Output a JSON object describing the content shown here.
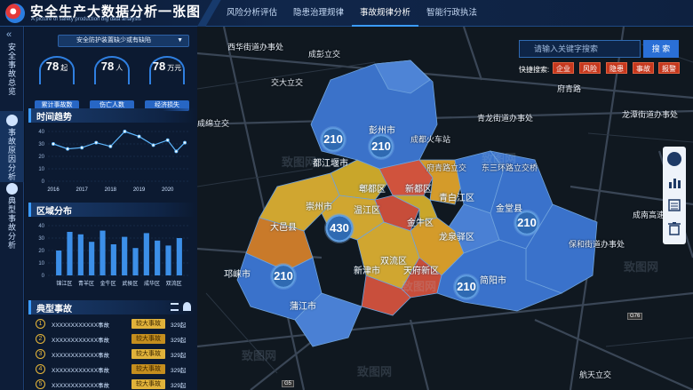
{
  "header": {
    "title": "安全生产大数据分析一张图",
    "subtitle": "A picture of safety production big data analysis",
    "nav": [
      "风险分析评估",
      "隐患治理规律",
      "事故规律分析",
      "智能行政执法"
    ],
    "active_nav": 2
  },
  "sidebar": {
    "tabs": [
      "安全事故总览",
      "事故原因分析",
      "典型事故分析"
    ]
  },
  "overview": {
    "dropdown": "安全防护装置缺少或有缺陷",
    "stats": [
      {
        "value": "78",
        "unit": "起",
        "label": "累计事故数"
      },
      {
        "value": "78",
        "unit": "人",
        "label": "伤亡人数"
      },
      {
        "value": "78",
        "unit": "万元",
        "label": "经济损失"
      }
    ]
  },
  "trend": {
    "title": "时间趋势",
    "chart_data": {
      "type": "line",
      "x": [
        "2016",
        "2017",
        "2018",
        "2019",
        "2020"
      ],
      "values": [
        30,
        26,
        27,
        31,
        28,
        40,
        36,
        29,
        33,
        24,
        31
      ],
      "x_points": [
        2016,
        2016.5,
        2017,
        2017.5,
        2018,
        2018.5,
        2019,
        2019.5,
        2020,
        2020.3,
        2020.6
      ],
      "yticks": [
        "0",
        "10",
        "20",
        "30",
        "40"
      ],
      "ylim": [
        0,
        40
      ]
    }
  },
  "region": {
    "title": "区域分布",
    "chart_data": {
      "type": "bar",
      "categories": [
        "锦江区",
        "青羊区",
        "金牛区",
        "武侯区",
        "成华区",
        "双流区"
      ],
      "values": [
        20,
        35,
        33,
        27,
        36,
        25,
        31,
        22,
        34,
        28,
        24,
        30
      ],
      "yticks": [
        "0",
        "10",
        "20",
        "30",
        "40"
      ],
      "ylim": [
        0,
        40
      ]
    }
  },
  "typical": {
    "title": "典型事故",
    "rows": [
      {
        "num": "1",
        "title": "XXXXXXXXXXXX事故",
        "tag": "较大事故",
        "date": "329起"
      },
      {
        "num": "2",
        "title": "XXXXXXXXXXXX事故",
        "tag": "较大事故",
        "date": "329起"
      },
      {
        "num": "3",
        "title": "XXXXXXXXXXXX事故",
        "tag": "较大事故",
        "date": "329起"
      },
      {
        "num": "4",
        "title": "XXXXXXXXXXXX事故",
        "tag": "较大事故",
        "date": "329起"
      },
      {
        "num": "5",
        "title": "XXXXXXXXXXXX事故",
        "tag": "较大事故",
        "date": "329起"
      }
    ]
  },
  "map": {
    "districts": [
      "彭州市",
      "都江堰市",
      "新都区",
      "郫都区",
      "青白江区",
      "崇州市",
      "温江区",
      "金牛区",
      "金堂县",
      "大邑县",
      "金牛区",
      "双流区",
      "天府新区",
      "新津市",
      "龙泉驿区",
      "简阳市",
      "邛崃市",
      "蒲江市",
      "青羊区",
      "成华区"
    ],
    "bubbles": [
      "210",
      "210",
      "430",
      "210",
      "210",
      "210"
    ],
    "places": [
      "西华街道办事处",
      "成彭立交",
      "交大立交",
      "成绵立交",
      "府青路立交",
      "青龙街道办事处",
      "龙潭街道办事处",
      "成都火车站",
      "府青路",
      "东三环路立交桥",
      "成南高速",
      "保和街道办事处",
      "成都立交",
      "七号线立交",
      "航天立交",
      "新津立交",
      "环城生态区",
      "崇州市",
      "川大立交",
      "成渝立交"
    ]
  },
  "search": {
    "placeholder": "请输入关键字搜索",
    "button": "搜 索",
    "quick_label": "快捷搜索:",
    "tags": [
      "企业",
      "风险",
      "隐患",
      "事故",
      "报警"
    ]
  }
}
